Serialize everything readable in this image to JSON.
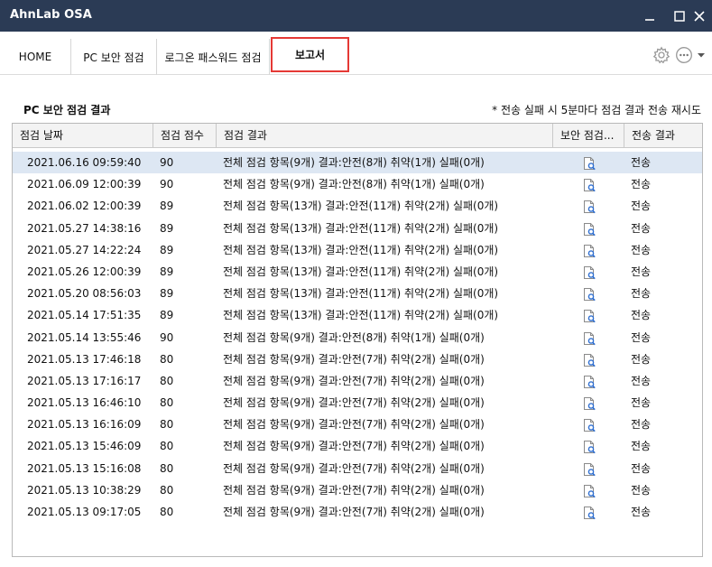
{
  "window": {
    "title": "AhnLab OSA"
  },
  "tabs": [
    {
      "label": "HOME"
    },
    {
      "label": "PC 보안 점검"
    },
    {
      "label": "로그온 패스워드 점검"
    },
    {
      "label": "보고서"
    }
  ],
  "report": {
    "section_title": "PC 보안 점검 결과",
    "note": "* 전송 실패 시 5분마다 점검 결과 전송 재시도",
    "columns": [
      "점검 날짜",
      "점검 점수",
      "점검 결과",
      "보안 점검...",
      "전송 결과"
    ],
    "rows": [
      {
        "date": "2021.06.16 09:59:40",
        "score": "90",
        "result": "전체 점검 항목(9개) 결과:안전(8개) 취약(1개) 실패(0개)",
        "status": "전송"
      },
      {
        "date": "2021.06.09 12:00:39",
        "score": "90",
        "result": "전체 점검 항목(9개) 결과:안전(8개) 취약(1개) 실패(0개)",
        "status": "전송"
      },
      {
        "date": "2021.06.02 12:00:39",
        "score": "89",
        "result": "전체 점검 항목(13개) 결과:안전(11개) 취약(2개) 실패(0개)",
        "status": "전송"
      },
      {
        "date": "2021.05.27 14:38:16",
        "score": "89",
        "result": "전체 점검 항목(13개) 결과:안전(11개) 취약(2개) 실패(0개)",
        "status": "전송"
      },
      {
        "date": "2021.05.27 14:22:24",
        "score": "89",
        "result": "전체 점검 항목(13개) 결과:안전(11개) 취약(2개) 실패(0개)",
        "status": "전송"
      },
      {
        "date": "2021.05.26 12:00:39",
        "score": "89",
        "result": "전체 점검 항목(13개) 결과:안전(11개) 취약(2개) 실패(0개)",
        "status": "전송"
      },
      {
        "date": "2021.05.20 08:56:03",
        "score": "89",
        "result": "전체 점검 항목(13개) 결과:안전(11개) 취약(2개) 실패(0개)",
        "status": "전송"
      },
      {
        "date": "2021.05.14 17:51:35",
        "score": "89",
        "result": "전체 점검 항목(13개) 결과:안전(11개) 취약(2개) 실패(0개)",
        "status": "전송"
      },
      {
        "date": "2021.05.14 13:55:46",
        "score": "90",
        "result": "전체 점검 항목(9개) 결과:안전(8개) 취약(1개) 실패(0개)",
        "status": "전송"
      },
      {
        "date": "2021.05.13 17:46:18",
        "score": "80",
        "result": "전체 점검 항목(9개) 결과:안전(7개) 취약(2개) 실패(0개)",
        "status": "전송"
      },
      {
        "date": "2021.05.13 17:16:17",
        "score": "80",
        "result": "전체 점검 항목(9개) 결과:안전(7개) 취약(2개) 실패(0개)",
        "status": "전송"
      },
      {
        "date": "2021.05.13 16:46:10",
        "score": "80",
        "result": "전체 점검 항목(9개) 결과:안전(7개) 취약(2개) 실패(0개)",
        "status": "전송"
      },
      {
        "date": "2021.05.13 16:16:09",
        "score": "80",
        "result": "전체 점검 항목(9개) 결과:안전(7개) 취약(2개) 실패(0개)",
        "status": "전송"
      },
      {
        "date": "2021.05.13 15:46:09",
        "score": "80",
        "result": "전체 점검 항목(9개) 결과:안전(7개) 취약(2개) 실패(0개)",
        "status": "전송"
      },
      {
        "date": "2021.05.13 15:16:08",
        "score": "80",
        "result": "전체 점검 항목(9개) 결과:안전(7개) 취약(2개) 실패(0개)",
        "status": "전송"
      },
      {
        "date": "2021.05.13 10:38:29",
        "score": "80",
        "result": "전체 점검 항목(9개) 결과:안전(7개) 취약(2개) 실패(0개)",
        "status": "전송"
      },
      {
        "date": "2021.05.13 09:17:05",
        "score": "80",
        "result": "전체 점검 항목(9개) 결과:안전(7개) 취약(2개) 실패(0개)",
        "status": "전송"
      }
    ]
  },
  "icons": {
    "view_report": "report-view-icon",
    "settings": "gear-icon",
    "more": "more-options-icon",
    "dropdown": "chevron-down-icon",
    "minimize": "minimize-icon",
    "maximize": "maximize-icon",
    "close": "close-icon"
  },
  "colors": {
    "titlebar": "#2b3b55",
    "active_tab_border": "#e53935",
    "selected_row": "#dde7f3"
  }
}
